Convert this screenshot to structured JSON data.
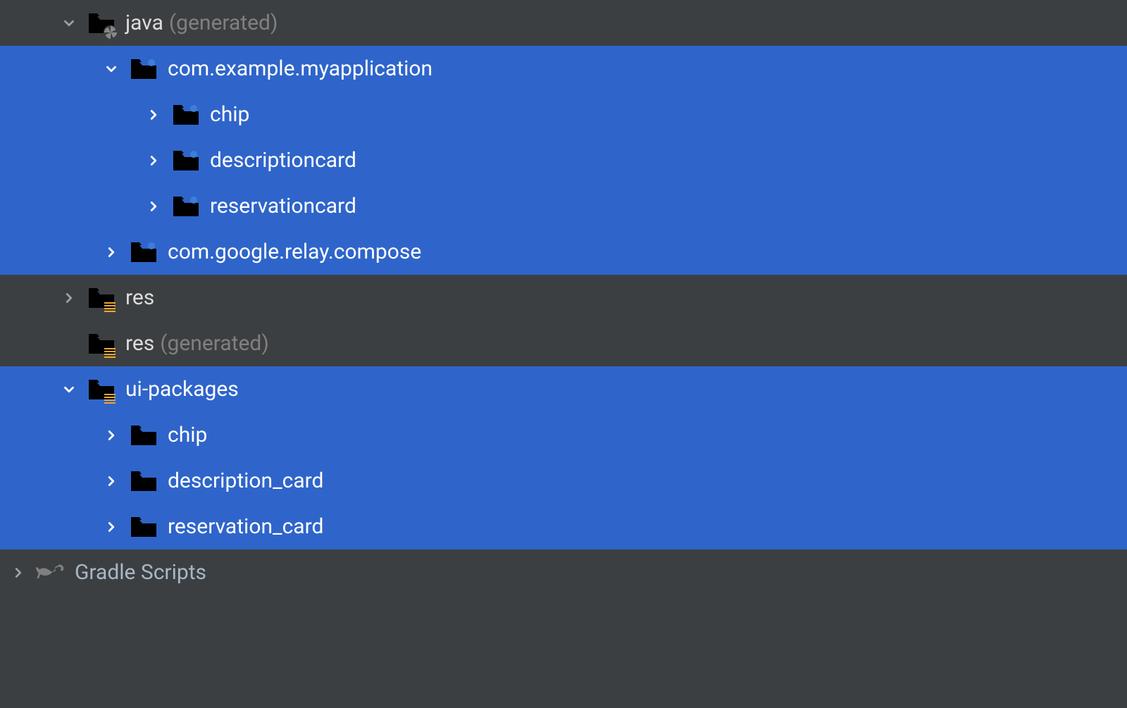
{
  "tree": {
    "java": {
      "label": "java",
      "hint": "(generated)"
    },
    "package_main": {
      "label": "com.example.myapplication"
    },
    "chip": {
      "label": "chip"
    },
    "descriptioncard": {
      "label": "descriptioncard"
    },
    "reservationcard": {
      "label": "reservationcard"
    },
    "package_relay": {
      "label": "com.google.relay.compose"
    },
    "res": {
      "label": "res"
    },
    "res_gen": {
      "label": "res",
      "hint": "(generated)"
    },
    "ui_packages": {
      "label": "ui-packages"
    },
    "chip2": {
      "label": "chip"
    },
    "description_card": {
      "label": "description_card"
    },
    "reservation_card": {
      "label": "reservation_card"
    },
    "gradle": {
      "label": "Gradle Scripts"
    }
  }
}
